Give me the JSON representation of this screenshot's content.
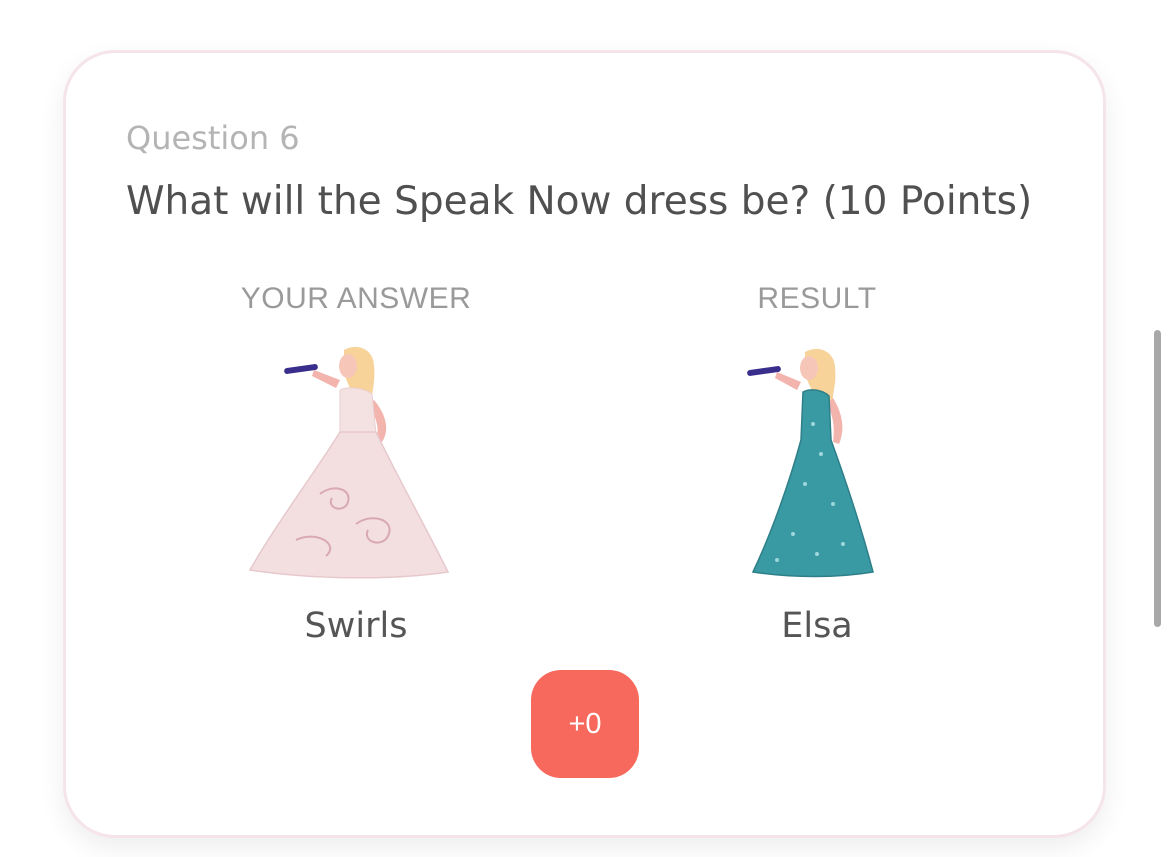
{
  "question": {
    "label": "Question 6",
    "text": "What will the Speak Now dress be? (10 Points)"
  },
  "your_answer": {
    "header": "YOUR ANSWER",
    "name": "Swirls",
    "dress_color": "#f3dfe0"
  },
  "result": {
    "header": "RESULT",
    "name": "Elsa",
    "dress_color": "#3a9aa3"
  },
  "score": {
    "label": "+0",
    "color": "#f8695d"
  }
}
